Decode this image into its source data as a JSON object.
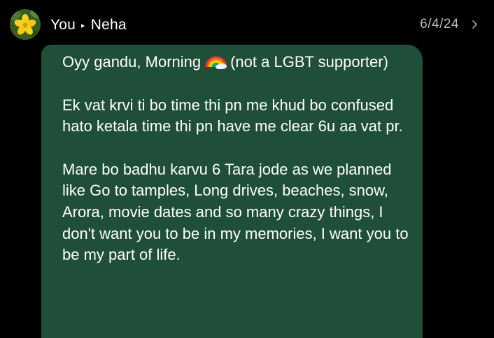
{
  "header": {
    "sender": "You",
    "recipient": "Neha",
    "separator_icon": "play-triangle-icon",
    "date": "6/4/24",
    "avatar_icon": "yellow-flower-avatar",
    "chevron_icon": "chevron-right-icon"
  },
  "message": {
    "line1_before": "Oyy gandu, Morning",
    "emoji": "rainbow-emoji",
    "line1_after": "(not a LGBT supporter)",
    "paragraph2": "Ek vat krvi ti bo time thi pn me khud bo confused hato ketala time thi pn have me clear 6u aa vat pr.",
    "paragraph3": "Mare bo badhu karvu 6 Tara jode as we planned like Go to tamples, Long drives, beaches, snow, Arora, movie dates  and so many crazy things, I don't want you to be in my memories, I want you to be my part of life."
  },
  "colors": {
    "background": "#000000",
    "bubble": "#1f4f38",
    "text": "#ffffff",
    "date": "#b9b9b9"
  }
}
